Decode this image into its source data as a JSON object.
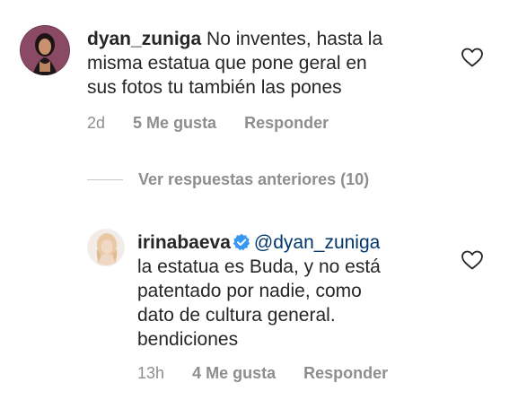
{
  "comment1": {
    "username": "dyan_zuniga",
    "text_line1": " No inventes, hasta la",
    "text_line2": "misma estatua que pone geral en",
    "text_line3": "sus fotos tu también las pones",
    "time": "2d",
    "likes": "5 Me gusta",
    "reply_label": "Responder"
  },
  "replies_toggle": {
    "label": "Ver respuestas anteriores (10)"
  },
  "comment2": {
    "username": "irinabaeva",
    "mention": "@dyan_zuniga",
    "text_line1": "la estatua es Buda, y no está",
    "text_line2": "patentado por nadie, como",
    "text_line3": "dato de cultura general.",
    "text_line4": "bendiciones",
    "time": "13h",
    "likes": "4 Me gusta",
    "reply_label": "Responder"
  },
  "icons": {
    "like": "heart-icon",
    "verified": "verified-badge-icon"
  },
  "colors": {
    "text": "#262626",
    "meta": "#8e8e8e",
    "mention": "#00376b",
    "verified": "#3897f0"
  }
}
